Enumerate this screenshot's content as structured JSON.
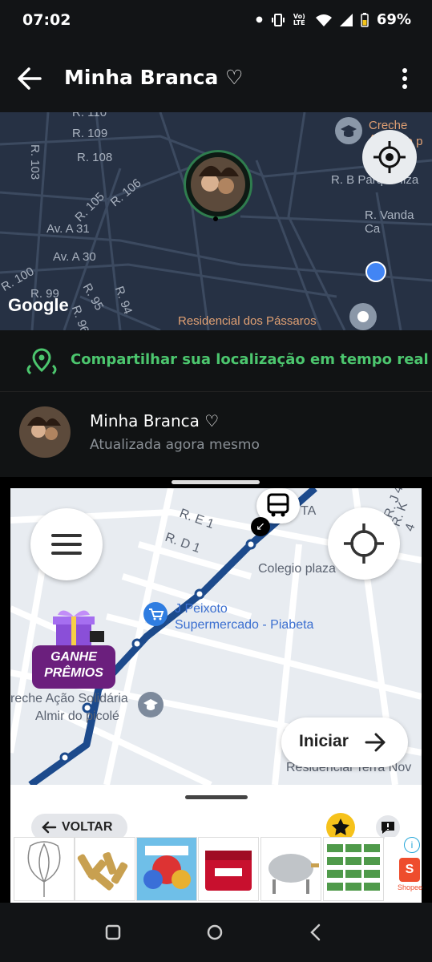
{
  "status_bar": {
    "time": "07:02",
    "battery": "69%",
    "network": "Vo) LTE"
  },
  "app_bar": {
    "title": "Minha Branca ♡"
  },
  "top_map": {
    "streets": [
      "R. 110",
      "R. 109",
      "R. 108",
      "R. 103",
      "R. 105",
      "R. 106",
      "Av. A 31",
      "Av. A 30",
      "R. 100",
      "R. 99",
      "R. 95",
      "R. 94",
      "R. 96",
      "R. B Parque Ilza",
      "R. Vanda Ca"
    ],
    "pois": [
      "Creche Ação",
      "Almir do p",
      "Residencial dos Pássaros"
    ],
    "google": "Google"
  },
  "share": {
    "label": "Compartilhar sua localização em tempo real"
  },
  "contact": {
    "name": "Minha Branca ♡",
    "status": "Atualizada agora mesmo"
  },
  "bottom_map": {
    "streets": [
      "R. E 1",
      "R. D 1",
      "TA",
      "R. J 4",
      "R. K 4"
    ],
    "places": [
      "Colegio plaza",
      "J Peixoto",
      "Supermercado - Piabeta",
      "reche Ação Solidária",
      "Almir do picolé",
      "Residencial Terra Nov"
    ],
    "promo": {
      "line1": "GANHE",
      "line2": "PRÊMIOS"
    },
    "start_button": "Iniciar"
  },
  "sheet": {
    "back_label": "VOLTAR",
    "ad_label": "Shopee"
  },
  "colors": {
    "route": "#1c4a8c",
    "share_green": "#4cc66e",
    "map_dark": "#263144"
  }
}
